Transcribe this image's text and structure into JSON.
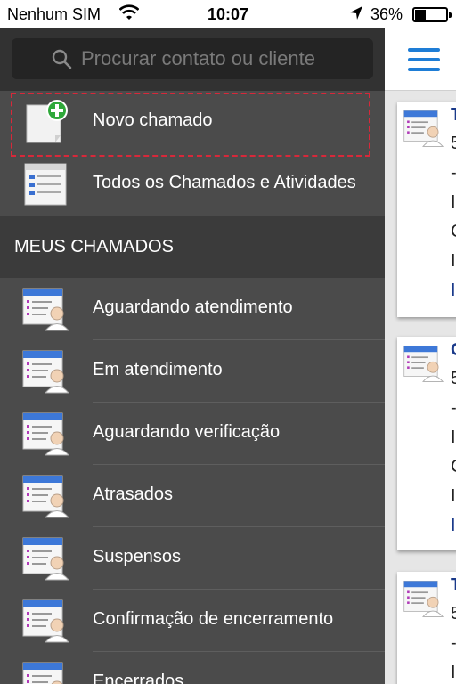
{
  "status_bar": {
    "carrier": "Nenhum SIM",
    "time": "10:07",
    "battery_percent_label": "36%",
    "battery_level": 0.36
  },
  "search": {
    "placeholder": "Procurar contato ou cliente"
  },
  "menu": {
    "top_items": [
      {
        "label": "Novo chamado",
        "icon": "new-ticket-icon",
        "highlighted": true
      },
      {
        "label": "Todos os Chamados e Atividades",
        "icon": "list-window-icon"
      }
    ],
    "section_title": "MEUS CHAMADOS",
    "section_items": [
      {
        "label": "Aguardando atendimento",
        "icon": "ticket-user-icon"
      },
      {
        "label": "Em atendimento",
        "icon": "ticket-user-icon"
      },
      {
        "label": "Aguardando verificação",
        "icon": "ticket-user-icon"
      },
      {
        "label": "Atrasados",
        "icon": "ticket-user-icon"
      },
      {
        "label": "Suspensos",
        "icon": "ticket-user-icon"
      },
      {
        "label": "Confirmação de encerramento",
        "icon": "ticket-user-icon"
      },
      {
        "label": "Encerrados",
        "icon": "ticket-user-icon"
      }
    ]
  },
  "content": {
    "menu_icon": "hamburger-icon",
    "cards": [
      {
        "title": "T",
        "lines": [
          "5",
          "-",
          "I",
          "C",
          "I"
        ],
        "link": "I"
      },
      {
        "title": "C",
        "lines": [
          "5",
          "-",
          "I",
          "C",
          "I"
        ],
        "link": "I"
      },
      {
        "title": "T",
        "lines": [
          "5",
          "-",
          "I"
        ],
        "link": ""
      }
    ]
  },
  "colors": {
    "menu_bg": "#4b4b4b",
    "section_bg": "#3b3b3b",
    "search_bg": "#323232",
    "accent_blue": "#1e7dd6",
    "highlight_red": "#d8283a"
  }
}
